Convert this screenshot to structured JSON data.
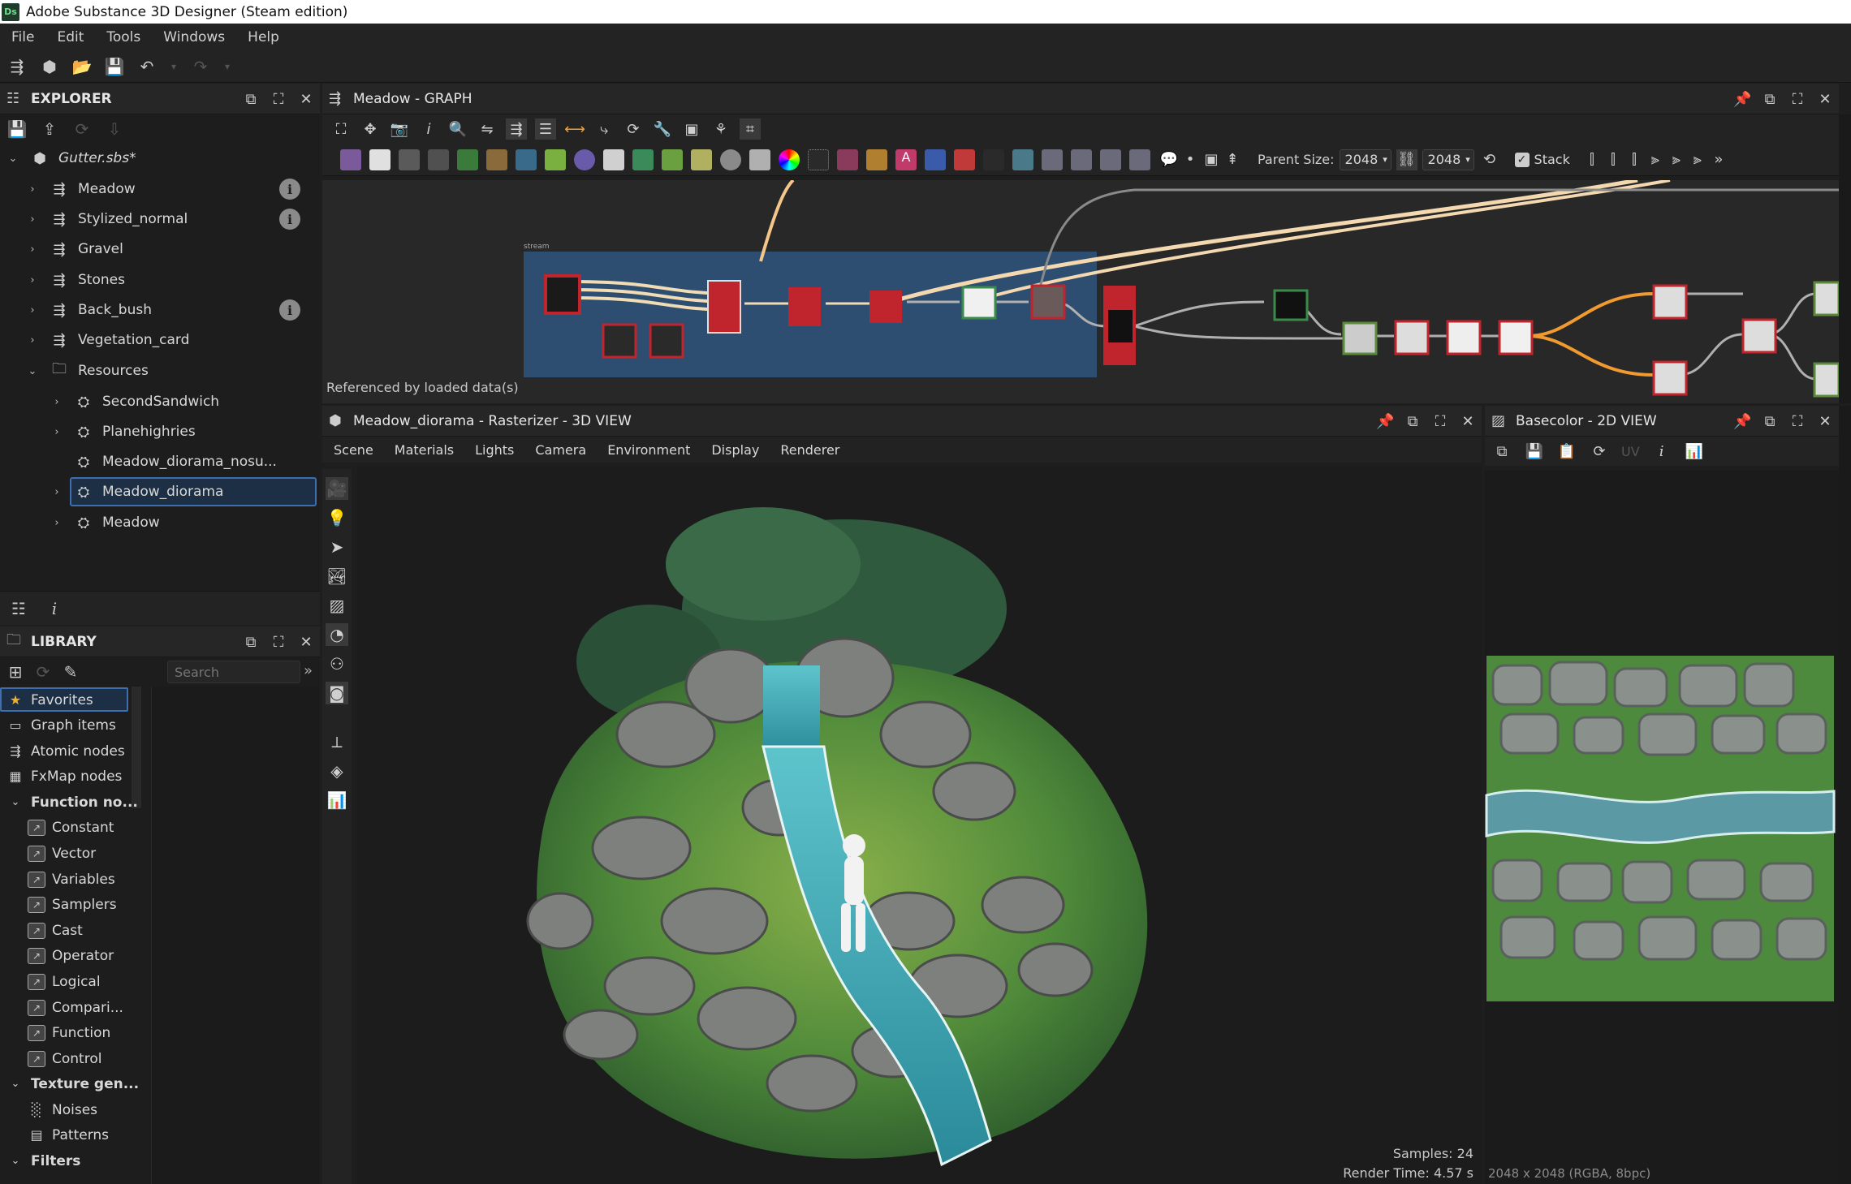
{
  "app": {
    "title": "Adobe Substance 3D Designer (Steam edition)",
    "logo_text": "Ds"
  },
  "menu": [
    "File",
    "Edit",
    "Tools",
    "Windows",
    "Help"
  ],
  "explorer": {
    "title": "EXPLORER",
    "package": "Gutter.sbs*",
    "items": [
      {
        "label": "Meadow",
        "icon": "graph-icon",
        "info": true
      },
      {
        "label": "Stylized_normal",
        "icon": "graph-icon",
        "info": true
      },
      {
        "label": "Gravel",
        "icon": "graph-icon",
        "info": false
      },
      {
        "label": "Stones",
        "icon": "graph-icon",
        "info": false
      },
      {
        "label": "Back_bush",
        "icon": "graph-icon",
        "info": true
      },
      {
        "label": "Vegetation_card",
        "icon": "graph-icon",
        "info": false
      }
    ],
    "resources_label": "Resources",
    "resources": [
      {
        "label": "SecondSandwich"
      },
      {
        "label": "Planehighries"
      },
      {
        "label": "Meadow_diorama_nosu..."
      },
      {
        "label": "Meadow_diorama",
        "selected": true
      },
      {
        "label": "Meadow"
      }
    ]
  },
  "library": {
    "title": "LIBRARY",
    "search_placeholder": "Search",
    "items": [
      {
        "label": "Favorites",
        "icon": "star-icon",
        "selected": true
      },
      {
        "label": "Graph items",
        "icon": "comment-icon"
      },
      {
        "label": "Atomic nodes",
        "icon": "atomic-icon"
      },
      {
        "label": "FxMap nodes",
        "icon": "grid-icon"
      }
    ],
    "function_group": "Function no...",
    "function_items": [
      "Constant",
      "Vector",
      "Variables",
      "Samplers",
      "Cast",
      "Operator",
      "Logical",
      "Compari...",
      "Function",
      "Control"
    ],
    "texture_group": "Texture gen...",
    "texture_items": [
      "Noises",
      "Patterns"
    ],
    "filters_group": "Filters"
  },
  "graph": {
    "title": "Meadow - GRAPH",
    "parent_size_label": "Parent Size:",
    "parent_size": "2048",
    "size_value": "2048",
    "stack_label": "Stack",
    "referenced_text": "Referenced by loaded data(s)",
    "frame_label": "stream"
  },
  "view3d": {
    "title": "Meadow_diorama - Rasterizer - 3D VIEW",
    "tabs": [
      "Scene",
      "Materials",
      "Lights",
      "Camera",
      "Environment",
      "Display",
      "Renderer"
    ],
    "samples": "Samples: 24",
    "render_time": "Render Time: 4.57 s"
  },
  "view2d": {
    "title": "Basecolor - 2D VIEW",
    "uv_label": "UV",
    "resolution": "2048 x 2048 (RGBA, 8bpc)"
  }
}
